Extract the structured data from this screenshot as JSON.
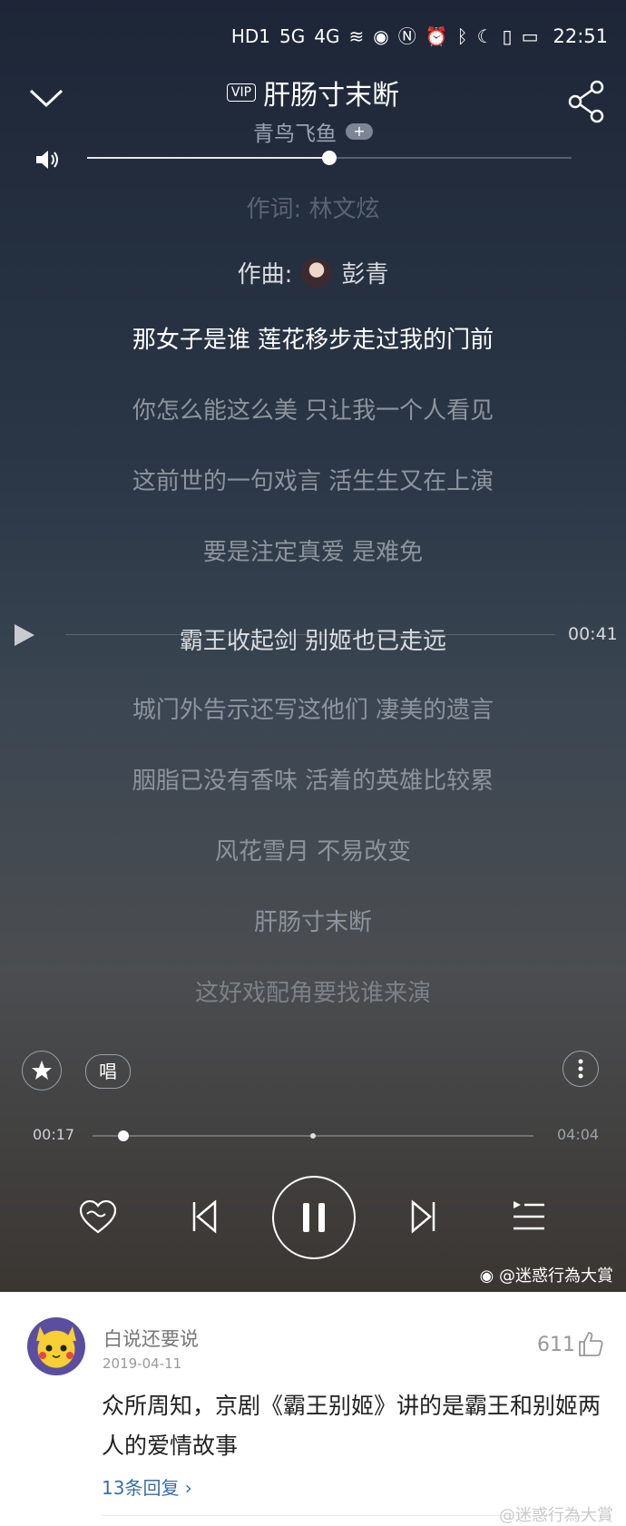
{
  "status_bar": {
    "signal_labels": [
      "HD1",
      "5G",
      "4G"
    ],
    "time": "22:51"
  },
  "header": {
    "vip_badge": "VIP",
    "song_title": "肝肠寸末断",
    "artist": "青鸟飞鱼",
    "add_label": "+"
  },
  "volume": {
    "level_fraction": 0.5
  },
  "lyrics": {
    "credits": [
      {
        "text": "作词: 林文炫"
      },
      {
        "label": "作曲:",
        "name": "彭青"
      }
    ],
    "lines": [
      "那女子是谁 莲花移步走过我的门前",
      "你怎么能这么美 只让我一个人看见",
      "这前世的一句戏言 活生生又在上演",
      "要是注定真爱 是难免",
      "霸王收起剑 别姬也已走远",
      "城门外告示还写这他们 凄美的遗言",
      "胭脂已没有香味 活着的英雄比较累",
      "风花雪月 不易改变",
      "肝肠寸末断",
      "这好戏配角要找谁来演"
    ],
    "current_index": 0,
    "seek_index": 4,
    "seek_time": "00:41"
  },
  "actions": {
    "sing_label": "唱"
  },
  "progress": {
    "elapsed": "00:17",
    "total": "04:04",
    "fraction": 0.07,
    "marker_fraction": 0.5
  },
  "watermark_player": "@迷惑行為大賞",
  "comment": {
    "username": "白说还要说",
    "date": "2019-04-11",
    "likes": "611",
    "text": "众所周知，京剧《霸王别姬》讲的是霸王和别姬两人的爱情故事",
    "replies": "13条回复 ›",
    "watermark": "@迷惑行為大賞"
  },
  "colors": {
    "accent": "#ffffff",
    "link": "#3a6ea5"
  }
}
